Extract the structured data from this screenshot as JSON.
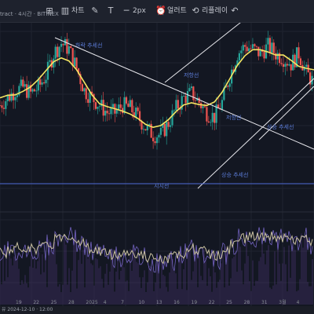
{
  "toolbar": {
    "symbol_text": "tract · 4시간 · BITINEX",
    "items": [
      {
        "icon": "grid-icon",
        "label": ""
      },
      {
        "icon": "chart-icon",
        "label": "차트"
      },
      {
        "icon": "pencil-icon",
        "label": ""
      },
      {
        "icon": "text-icon",
        "label": ""
      },
      {
        "icon": "line-icon",
        "label": "2px"
      },
      {
        "icon": "alert-icon",
        "label": "얼러트"
      },
      {
        "icon": "replay-icon",
        "label": "리플레이"
      },
      {
        "icon": "undo-icon",
        "label": ""
      }
    ]
  },
  "annotations": {
    "downtrend": "하락 추세선",
    "resistance": "저항선",
    "support_line": "지지선",
    "uptrend": "상승 추세선",
    "breakout": "상승 추세선",
    "upper": "저항선"
  },
  "xaxis": {
    "ticks": [
      "19",
      "22",
      "25",
      "28",
      "2025",
      "4",
      "7",
      "10",
      "13",
      "16",
      "19",
      "22",
      "25",
      "28",
      "31",
      "3월",
      "4"
    ]
  },
  "timebar": {
    "info": "유 2024-12-10 · 12:00"
  },
  "chart_data": {
    "type": "line",
    "title": "",
    "xlabel": "",
    "ylabel": "",
    "note": "candlestick price chart with moving average and an oscillator panel below",
    "series": [
      {
        "name": "",
        "values": [
          0.5,
          0.55,
          0.6,
          0.62,
          0.58,
          0.62,
          0.7,
          0.85,
          0.92,
          0.88,
          0.75,
          0.6,
          0.55,
          0.5,
          0.45,
          0.45,
          0.5,
          0.48,
          0.42,
          0.35,
          0.3,
          0.3,
          0.38,
          0.48,
          0.55,
          0.58,
          0.52,
          0.45,
          0.42,
          0.52,
          0.7,
          0.85,
          0.9,
          0.88,
          0.85,
          0.9,
          0.85,
          0.82,
          0.78,
          0.85,
          0.72,
          0.65
        ]
      }
    ],
    "ylim": [
      0,
      1
    ]
  },
  "colors": {
    "up": "#26a69a",
    "down": "#ef5350",
    "ma": "#f5e663",
    "trend": "#e9e9ee",
    "support": "#4f6bd8",
    "osc": "#c9c0a0",
    "osc2": "#7d6bd1"
  }
}
